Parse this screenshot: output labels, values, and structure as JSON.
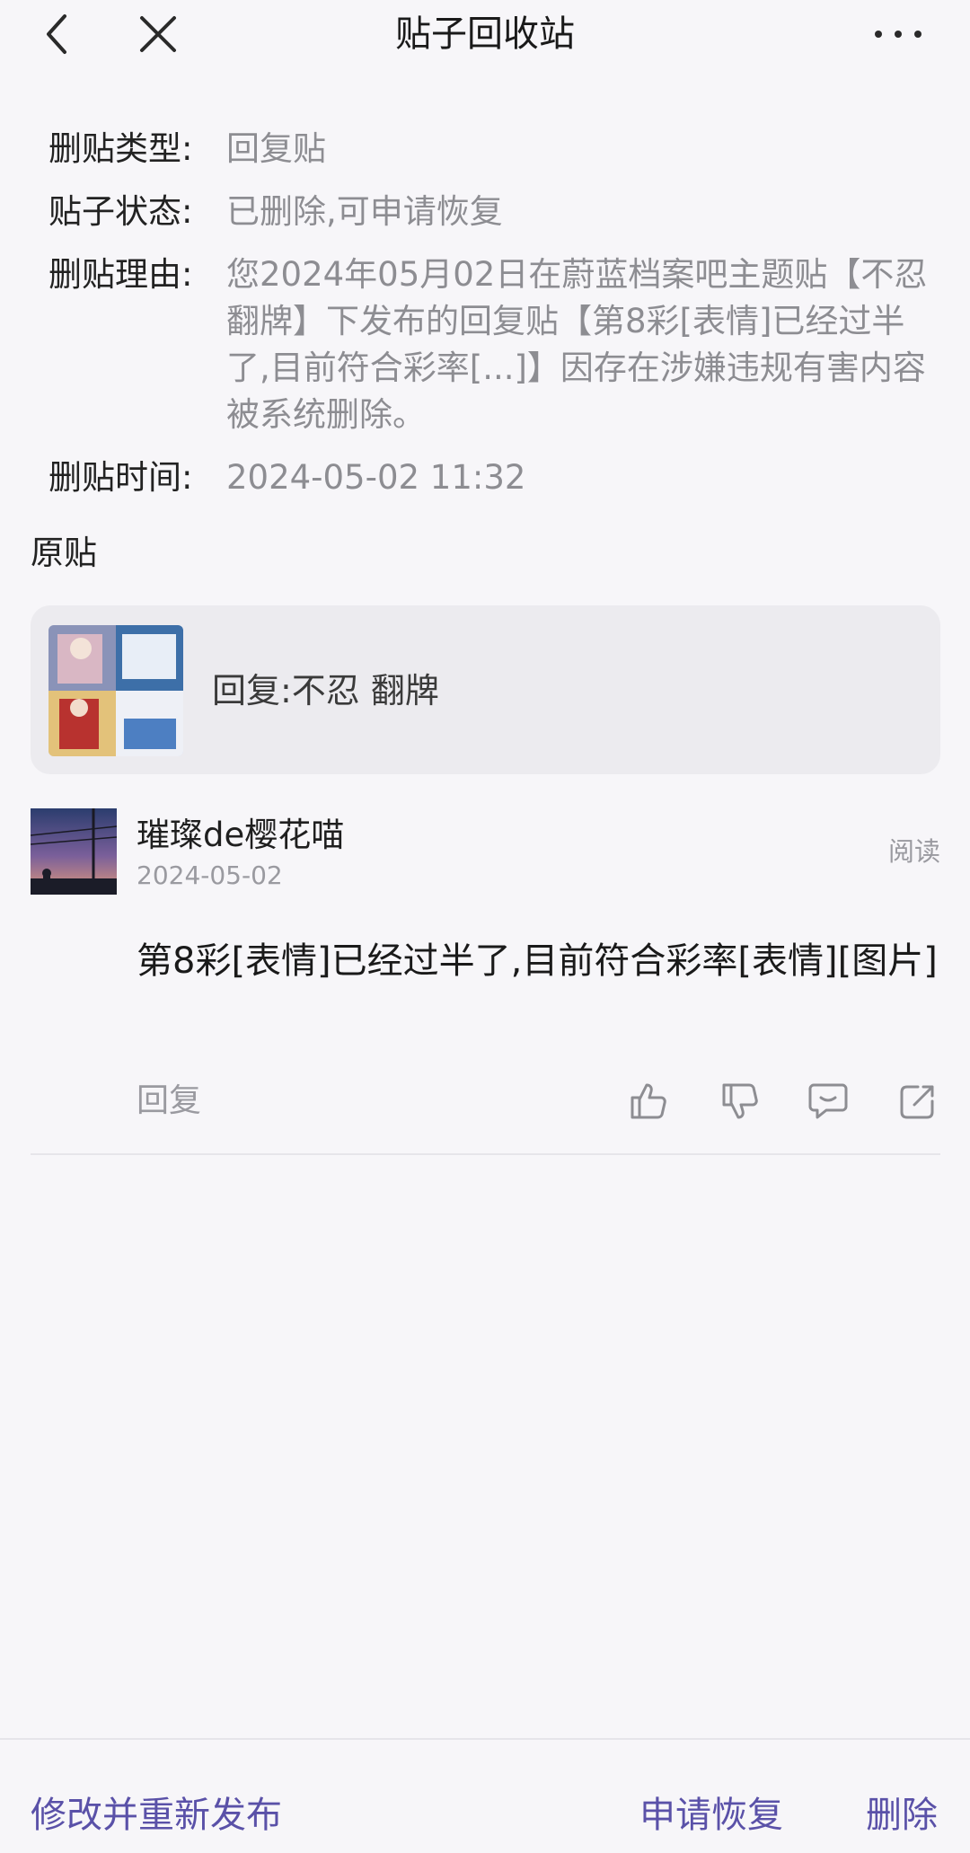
{
  "header": {
    "title": "贴子回收站",
    "back_icon": "back-icon",
    "close_icon": "close-icon",
    "more_icon": "more-icon"
  },
  "info": {
    "type_label": "删贴类型:",
    "type_value": "回复贴",
    "status_label": "贴子状态:",
    "status_value": "已删除,可申请恢复",
    "reason_label": "删贴理由:",
    "reason_value": "您2024年05月02日在蔚蓝档案吧主题贴【不忍 翻牌】下发布的回复贴【第8彩[表情]已经过半了,目前符合彩率[...]】因存在涉嫌违规有害内容被系统删除。",
    "time_label": "删贴时间:",
    "time_value": "2024-05-02 11:32"
  },
  "original": {
    "section_title": "原贴",
    "card_title": "回复:不忍 翻牌"
  },
  "reply": {
    "username": "璀璨de樱花喵",
    "date": "2024-05-02",
    "read_label": "阅读",
    "content": " 第8彩[表情]已经过半了,目前符合彩率[表情][图片]",
    "reply_label": "回复",
    "icons": [
      "thumbs-up-icon",
      "thumbs-down-icon",
      "comment-icon",
      "share-icon"
    ]
  },
  "bottom": {
    "republish_label": "修改并重新发布",
    "restore_label": "申请恢复",
    "delete_label": "删除"
  },
  "colors": {
    "accent": "#5a51a8",
    "muted_text": "#8d8d92",
    "background": "#f7f6f9"
  }
}
